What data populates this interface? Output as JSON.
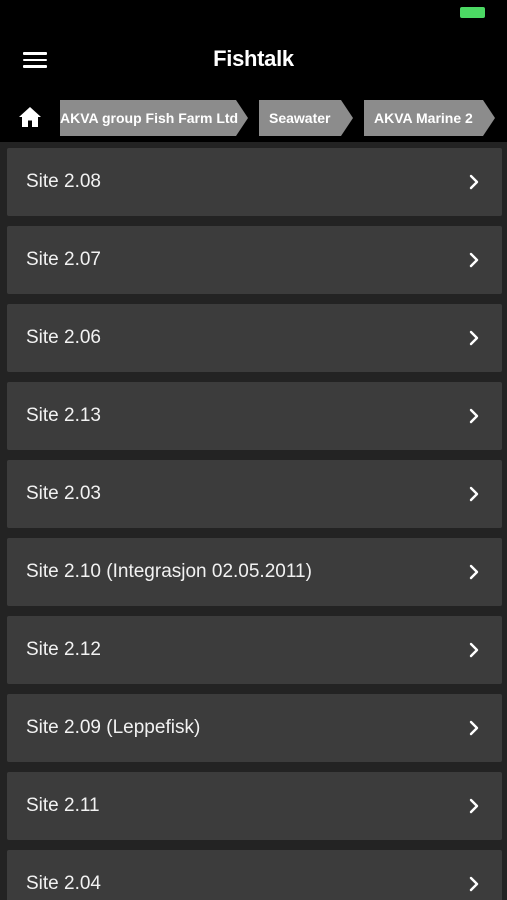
{
  "header": {
    "title": "Fishtalk",
    "menu_icon": "hamburger-menu-icon"
  },
  "colors": {
    "battery": "#4cd964",
    "bar_background": "#000000",
    "screen_background": "#232323",
    "item_background": "#3c3c3c",
    "breadcrumb_background": "#8c8c8c"
  },
  "breadcrumb": {
    "home_icon": "home-icon",
    "items": [
      {
        "label": "AKVA group Fish Farm Ltd"
      },
      {
        "label": "Seawater"
      },
      {
        "label": "AKVA Marine 2"
      }
    ]
  },
  "sites": [
    {
      "label": "Site 2.08"
    },
    {
      "label": "Site 2.07"
    },
    {
      "label": "Site 2.06"
    },
    {
      "label": "Site 2.13"
    },
    {
      "label": "Site 2.03"
    },
    {
      "label": "Site 2.10 (Integrasjon 02.05.2011)"
    },
    {
      "label": "Site 2.12"
    },
    {
      "label": "Site 2.09 (Leppefisk)"
    },
    {
      "label": "Site 2.11"
    },
    {
      "label": "Site 2.04"
    }
  ]
}
